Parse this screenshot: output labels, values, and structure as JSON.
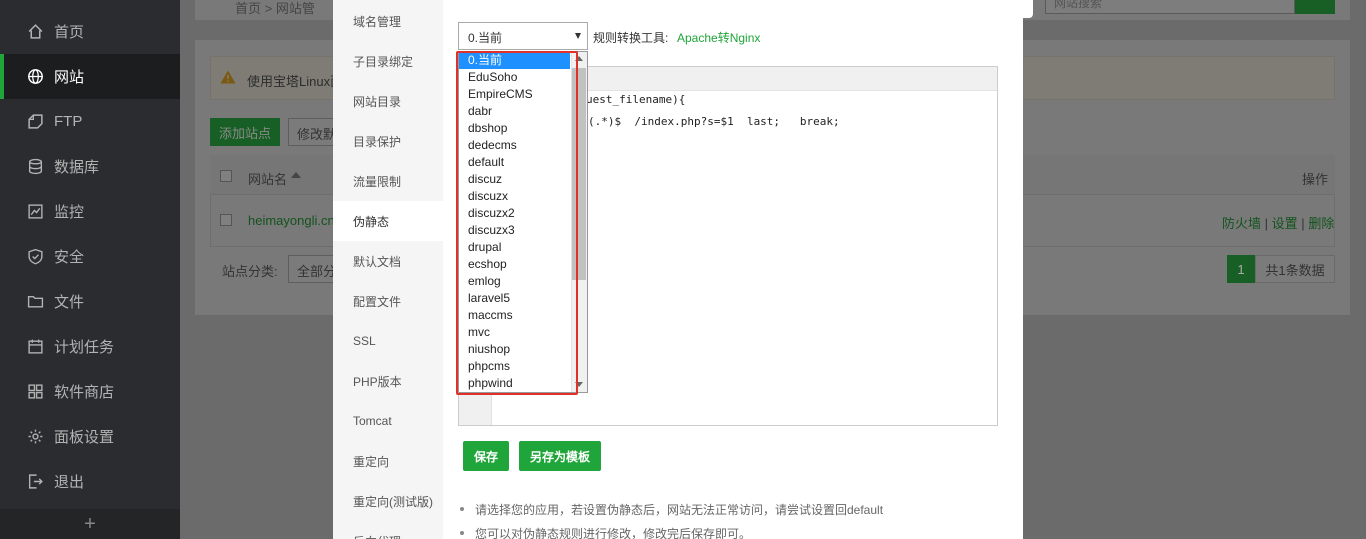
{
  "sidebar": {
    "items": [
      {
        "label": "首页",
        "icon": "home-icon"
      },
      {
        "label": "网站",
        "icon": "globe-icon"
      },
      {
        "label": "FTP",
        "icon": "ftp-icon"
      },
      {
        "label": "数据库",
        "icon": "database-icon"
      },
      {
        "label": "监控",
        "icon": "monitor-icon"
      },
      {
        "label": "安全",
        "icon": "shield-icon"
      },
      {
        "label": "文件",
        "icon": "folder-icon"
      },
      {
        "label": "计划任务",
        "icon": "calendar-icon"
      },
      {
        "label": "软件商店",
        "icon": "apps-icon"
      },
      {
        "label": "面板设置",
        "icon": "gear-icon"
      },
      {
        "label": "退出",
        "icon": "logout-icon"
      }
    ],
    "active_index": 1,
    "add_label": "+"
  },
  "background": {
    "breadcrumb_text": "首页  >  网站管",
    "search_placeholder": "网站搜索",
    "notice_text": "使用宝塔Linux面",
    "add_site_label": "添加站点",
    "modify_label": "修改默认",
    "table_header_name": "网站名",
    "table_header_ops": "操作",
    "row_name": "heimayongli.cn",
    "row_ops": [
      "防火墙",
      "设置",
      "删除"
    ],
    "category_label": "站点分类:",
    "category_value": "全部分类",
    "page_current": "1",
    "page_total": "共1条数据"
  },
  "modal": {
    "tabs": [
      "域名管理",
      "子目录绑定",
      "网站目录",
      "目录保护",
      "流量限制",
      "伪静态",
      "默认文档",
      "配置文件",
      "SSL",
      "PHP版本",
      "Tomcat",
      "重定向",
      "重定向(测试版)",
      "反向代理"
    ],
    "active_tab_index": 5,
    "select_value": "0.当前",
    "convert_label": "规则转换工具:",
    "convert_link": "Apache转Nginx",
    "code_lines": [
      {
        "pre": "",
        "keyword": "",
        "post": "uest_filename){"
      },
      {
        "pre": "",
        "keyword": "",
        "post": "(.*)$  /index.php?s=$1  last;   break;"
      }
    ],
    "save_label": "保存",
    "save_template_label": "另存为模板",
    "tips": [
      "请选择您的应用，若设置伪静态后，网站无法正常访问，请尝试设置回default",
      "您可以对伪静态规则进行修改，修改完后保存即可。"
    ]
  },
  "dropdown": {
    "options": [
      "0.当前",
      "EduSoho",
      "EmpireCMS",
      "dabr",
      "dbshop",
      "dedecms",
      "default",
      "discuz",
      "discuzx",
      "discuzx2",
      "discuzx3",
      "drupal",
      "ecshop",
      "emlog",
      "laravel5",
      "maccms",
      "mvc",
      "niushop",
      "phpcms",
      "phpwind"
    ],
    "selected_index": 0
  },
  "colors": {
    "brand_green": "#20a53a",
    "selection_blue": "#1e90ff",
    "highlight_red": "#e0302a"
  }
}
